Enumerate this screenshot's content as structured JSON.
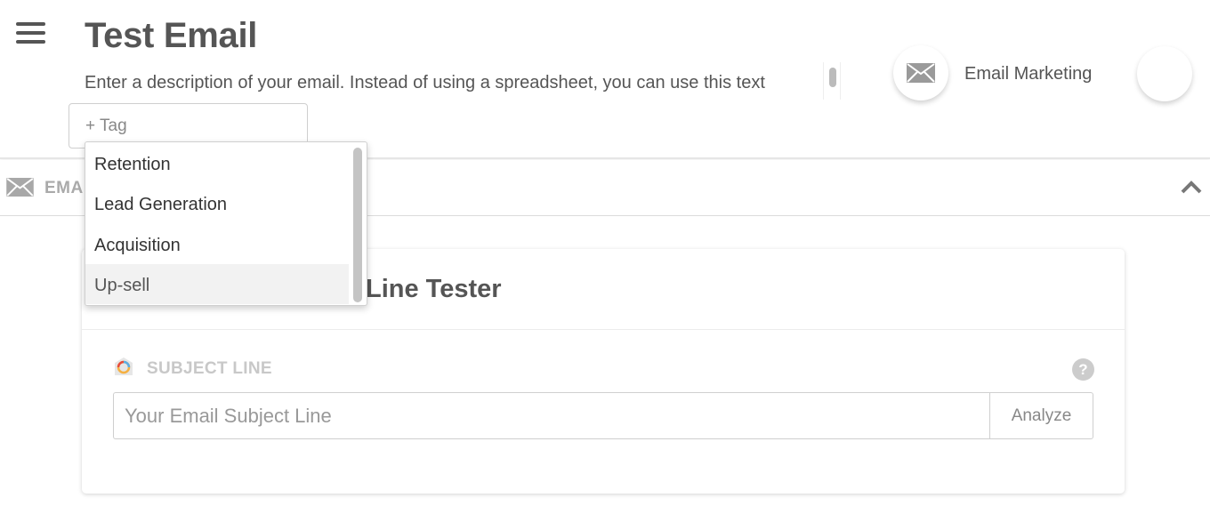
{
  "header": {
    "title": "Test Email",
    "description": "Enter a description of your email. Instead of using a spreadsheet, you can use this text",
    "tag_placeholder": "+ Tag",
    "campaign_name": "Email Marketing"
  },
  "section": {
    "label": "EMA"
  },
  "card": {
    "title": "Line Tester",
    "subject_label": "SUBJECT LINE",
    "help_text": "?",
    "subject_placeholder": "Your Email Subject Line",
    "analyze_label": "Analyze"
  },
  "tag_dropdown": {
    "options": [
      "Retention",
      "Lead Generation",
      "Acquisition",
      "Up-sell"
    ],
    "highlighted": "Up-sell"
  },
  "colors": {
    "text_dark": "#555555",
    "muted": "#aaaaaa",
    "border": "#cfcfcf"
  }
}
